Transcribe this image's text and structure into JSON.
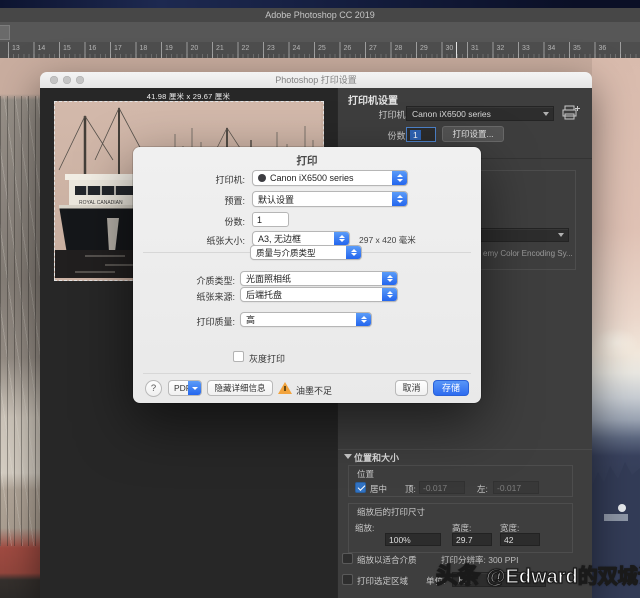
{
  "app": {
    "title": "Adobe Photoshop CC 2019"
  },
  "ruler": {
    "numbers": [
      "13",
      "14",
      "15",
      "16",
      "17",
      "18",
      "19",
      "20",
      "21",
      "22",
      "23",
      "24",
      "25",
      "26",
      "27",
      "28",
      "29",
      "30",
      "31",
      "32",
      "33",
      "34",
      "35",
      "36"
    ]
  },
  "print_window": {
    "title": "Photoshop 打印设置",
    "preview_dimensions": "41.98 厘米 x 29.67 厘米",
    "boat_text": "ROYAL CANADIAN",
    "printer_setup": {
      "heading": "打印机设置",
      "printer_label": "打印机:",
      "printer_value": "Canon iX6500 series",
      "copies_label": "份数:",
      "copies_value": "1",
      "print_settings_button": "打印设置..."
    },
    "color_section_fragment": "emy Color Encoding Sy...",
    "position_size": {
      "header": "位置和大小",
      "position_label": "位置",
      "center_label": "居中",
      "top_label": "顶:",
      "top_value": "-0.017",
      "left_label": "左:",
      "left_value": "-0.017",
      "scaled_label": "缩放后的打印尺寸",
      "scale_label": "缩放:",
      "scale_value": "100%",
      "height_label": "高度:",
      "height_value": "29.7",
      "width_label": "宽度:",
      "width_value": "42",
      "fit_media_label": "缩放以适合介质",
      "resolution_label": "打印分辨率: 300 PPI",
      "print_selected_label": "打印选定区域",
      "units_label": "单位:",
      "units_value": "厘米"
    }
  },
  "print_dialog": {
    "title": "打印",
    "printer_label": "打印机:",
    "printer_value": "Canon iX6500 series",
    "preset_label": "预置:",
    "preset_value": "默认设置",
    "copies_label": "份数:",
    "copies_value": "1",
    "paper_label": "纸张大小:",
    "paper_value": "A3, 无边框",
    "paper_dims": "297 x 420 毫米",
    "section_value": "质量与介质类型",
    "media_label": "介质类型:",
    "media_value": "光面照相纸",
    "source_label": "纸张来源:",
    "source_value": "后端托盘",
    "quality_label": "打印质量:",
    "quality_value": "高",
    "grayscale_label": "灰度打印",
    "help_label": "?",
    "pdf_label": "PDF",
    "details_button": "隐藏详细信息",
    "ink_warning": "油墨不足",
    "cancel_button": "取消",
    "save_button": "存储"
  },
  "watermark": {
    "badge": "头条",
    "handle": "@Edward的双城记"
  },
  "colors": {
    "accent_blue": "#2e6ef0",
    "save_blue": "#3f7ef5",
    "warning_yellow": "#f2a33c",
    "panel_gray": "#3e3e3e"
  }
}
